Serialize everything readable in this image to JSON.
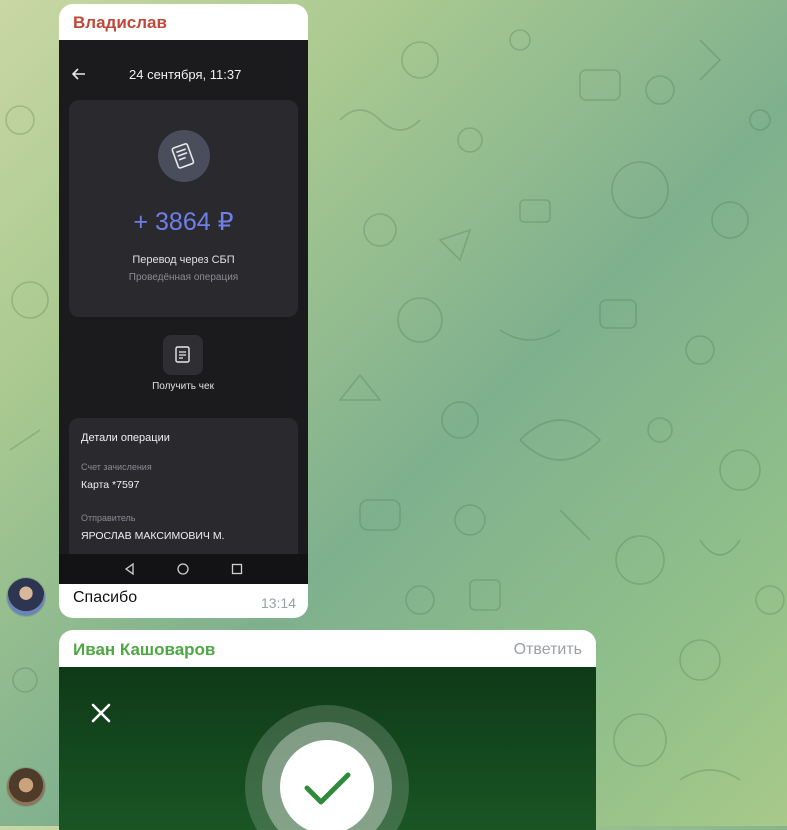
{
  "colors": {
    "wallpaper_accent": "#7fb08e",
    "sender_1": "#c0473a",
    "sender_2": "#4fa743",
    "amount": "#6f7fe8",
    "success_bg": "#154a1f",
    "check": "#2f8a3c"
  },
  "message_1": {
    "sender": "Владислав",
    "screenshot": {
      "date": "24 сентября, 11:37",
      "amount": "+ 3864 ₽",
      "operation_type": "Перевод через СБП",
      "operation_status": "Проведённая операция",
      "receipt_label": "Получить чек",
      "details": {
        "title": "Детали операции",
        "account_label": "Счет зачисления",
        "account_value": "Карта *7597",
        "sender_label": "Отправитель",
        "sender_value": "ЯРОСЛАВ МАКСИМОВИЧ М."
      }
    },
    "text": "Спасибо",
    "time": "13:14"
  },
  "message_2": {
    "sender": "Иван Кашоваров",
    "reply": "Ответить"
  }
}
